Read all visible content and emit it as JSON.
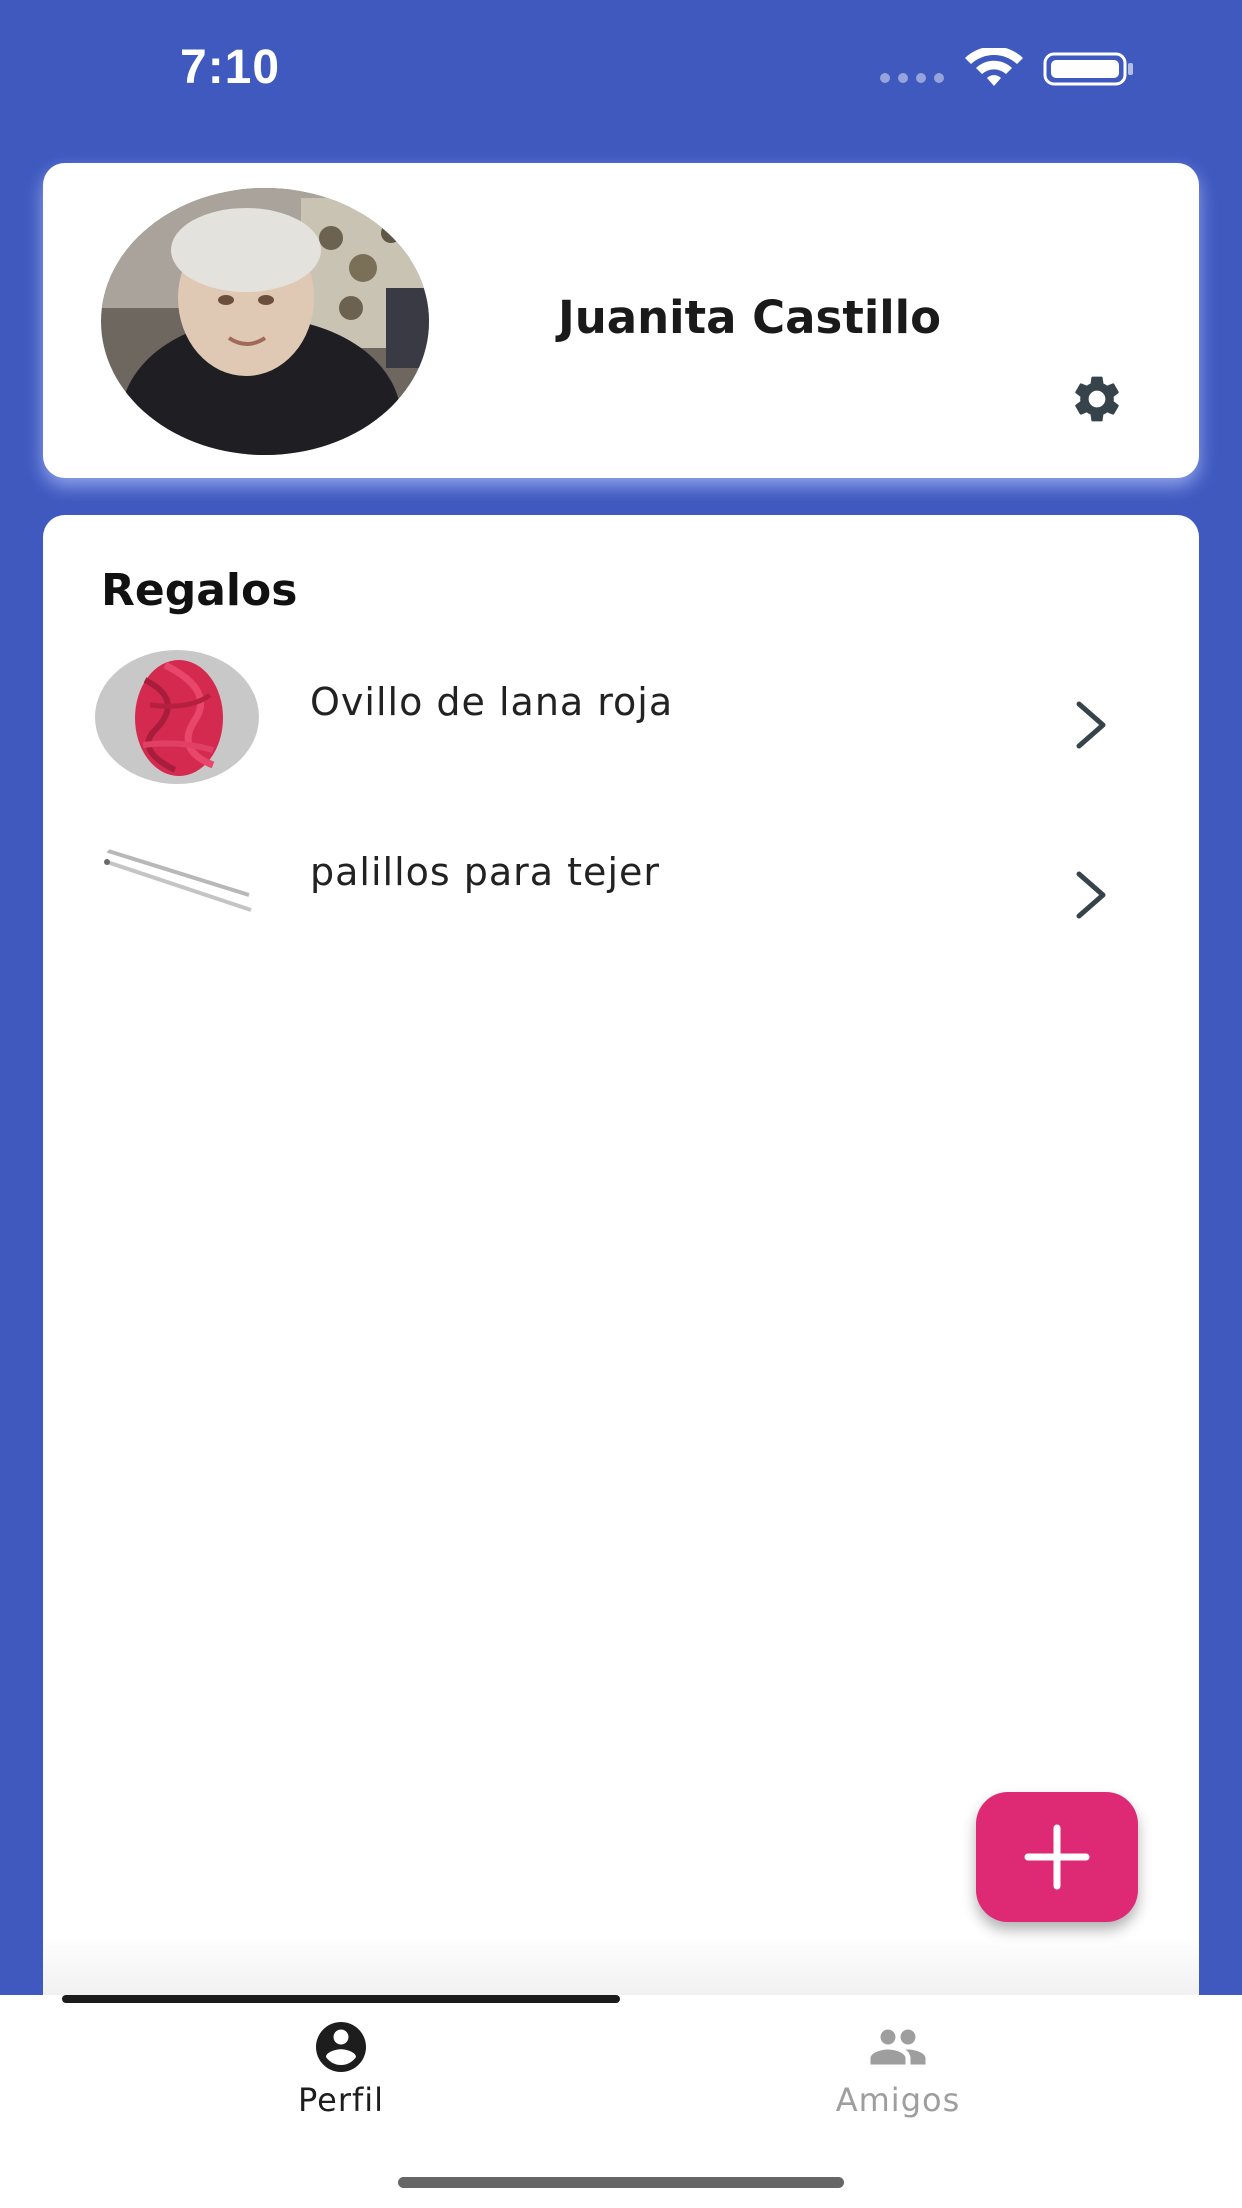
{
  "status_bar": {
    "time": "7:10",
    "icons": [
      "signal-icon",
      "wifi-icon",
      "battery-icon"
    ]
  },
  "profile": {
    "name": "Juanita Castillo",
    "avatar": "avatar-photo",
    "settings_icon": "gear-icon"
  },
  "gifts": {
    "title": "Regalos",
    "items": [
      {
        "label": "Ovillo de lana roja",
        "thumbnail": "red-yarn-image",
        "icon": "chevron-right-icon"
      },
      {
        "label": "palillos para tejer",
        "thumbnail": "knitting-needles-image",
        "icon": "chevron-right-icon"
      }
    ]
  },
  "fab": {
    "icon": "plus-icon"
  },
  "tabs": [
    {
      "label": "Perfil",
      "icon": "person-icon",
      "active": true
    },
    {
      "label": "Amigos",
      "icon": "people-icon",
      "active": false
    }
  ],
  "colors": {
    "background": "#3f59bf",
    "accent": "#de2a74",
    "card": "#ffffff",
    "tab_active": "#1d1d1d",
    "tab_inactive": "#9e9e9e"
  }
}
